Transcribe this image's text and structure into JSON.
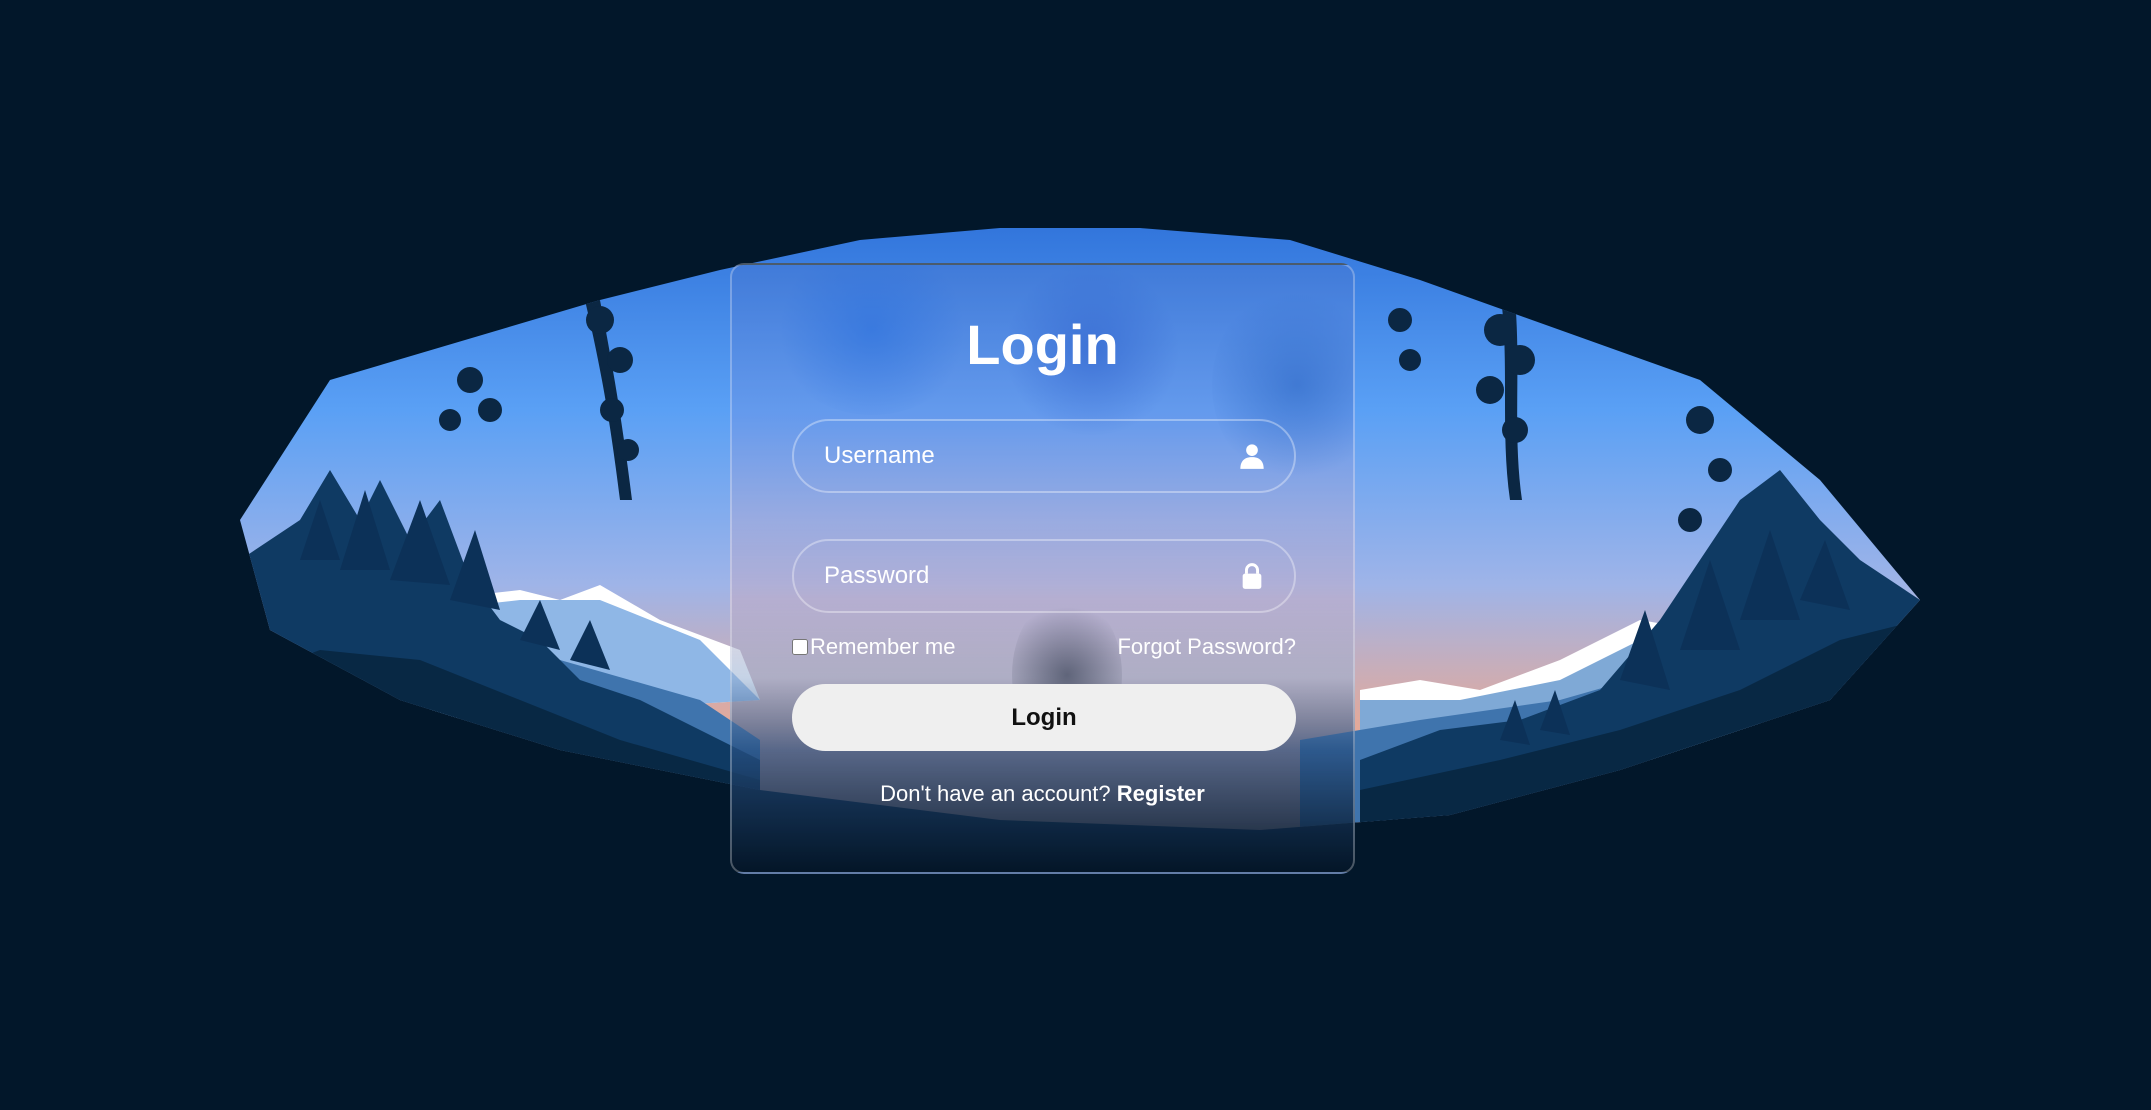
{
  "colors": {
    "page_background": "#02172a",
    "sky_top": "#3c86ea",
    "sky_horizon": "#e3a99a",
    "button_background": "#efefef",
    "text": "#ffffff"
  },
  "login": {
    "title": "Login",
    "username_placeholder": "Username",
    "username_icon": "user-icon",
    "password_placeholder": "Password",
    "password_icon": "lock-icon",
    "remember_label": "Remember me",
    "remember_checked": false,
    "forgot_label": "Forgot Password?",
    "submit_label": "Login",
    "register_prompt": "Don't have an account?",
    "register_link": "Register"
  }
}
